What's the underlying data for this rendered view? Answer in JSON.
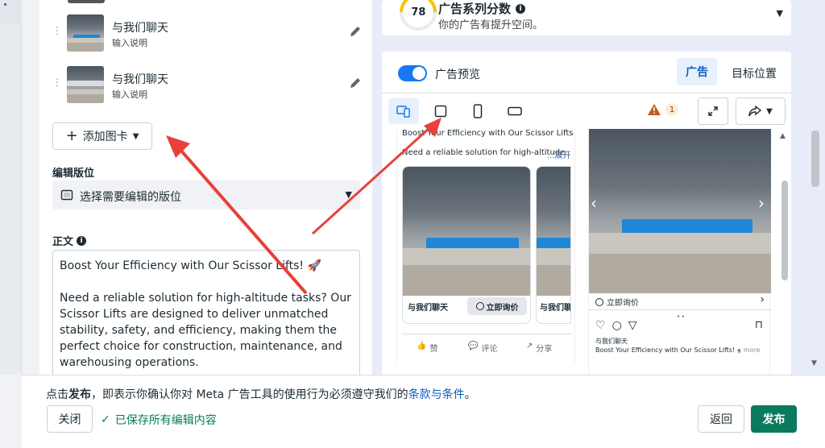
{
  "cards": [
    {
      "title": "与我们聊天",
      "subtitle": "输入说明"
    },
    {
      "title": "与我们聊天",
      "subtitle": "输入说明"
    }
  ],
  "add_card_label": "添加图卡",
  "placement": {
    "label": "编辑版位",
    "select_text": "选择需要编辑的版位"
  },
  "body_text": {
    "label": "正文",
    "value": "Boost Your Efficiency with Our Scissor Lifts! 🚀\n\nNeed a reliable solution for high-altitude tasks? Our Scissor Lifts are designed to deliver unmatched stability, safety, and efficiency, making them the perfect choice for construction, maintenance, and warehousing operations."
  },
  "score": {
    "value": "78",
    "title": "广告系列分数",
    "subtitle": "你的广告有提升空间。"
  },
  "preview": {
    "toggle_label": "广告预览",
    "tab_ad": "广告",
    "tab_target": "目标位置",
    "warning_count": "1"
  },
  "fb_post": {
    "headline": "Boost Your Efficiency with Our Scissor Lifts! 🚀",
    "text": "Need a reliable solution for high-altitude",
    "more": "...展开",
    "card1_title": "与我们聊天",
    "card1_cta": "立即询价",
    "card2_title": "与我们聊",
    "like": "赞",
    "comment": "评论",
    "share": "分享"
  },
  "ig_post": {
    "cta": "立即询价",
    "account": "与我们聊天",
    "caption": "Boost Your Efficiency with Our Scissor Lifts! 🚀 ...",
    "more": "more"
  },
  "footer": {
    "notice_prefix": "点击",
    "notice_bold": "发布",
    "notice_middle": "，即表示你确认你对 Meta 广告工具的使用行为必须遵守我们的",
    "notice_link": "条款与条件",
    "notice_end": "。",
    "close_label": "关闭",
    "saved_label": "已保存所有编辑内容",
    "back_label": "返回",
    "publish_label": "发布"
  },
  "colors": {
    "accent": "#1877f2",
    "publish": "#0a7a5c",
    "score_ring": "#f5c400",
    "annotation_arrow": "#e8403a"
  }
}
